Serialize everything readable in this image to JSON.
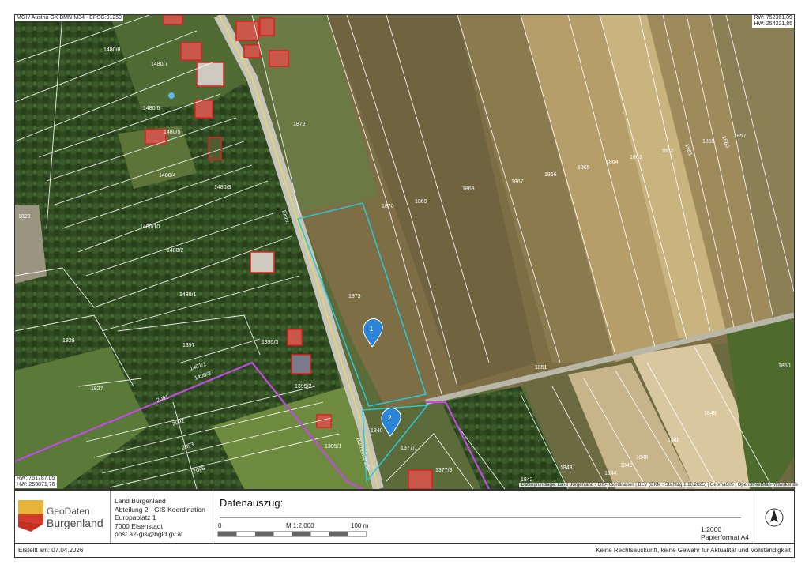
{
  "map": {
    "crs_label": "MGI / Austria GK BMN-M34 - EPSG:31259",
    "coords_top_right": [
      "RW: 752361,09",
      "HW: 254221,85"
    ],
    "coords_bottom_left": [
      "RW: 751787,05",
      "HW: 253871,76"
    ],
    "attribution": "Datengrundlage: Land Burgenland - GIS-Koordination | BEV (DKM - Stichtag 1.10.2025) | GeomaGIS | OpenStreetMap-Mitwirkende",
    "parcels": [
      "1480/8",
      "1480/7",
      "1480/6",
      "1480/5",
      "1480/4",
      "1480/3",
      "1480/10",
      "1480/2",
      "1480/1",
      "1829",
      "1828",
      "1827",
      "1397",
      "1395/3",
      "1395/2",
      "1401/1",
      "1400/3",
      "1872",
      "1873",
      "1870",
      "1869",
      "1868",
      "1867",
      "1866",
      "1865",
      "1864",
      "1863",
      "1862",
      "1861",
      "1860",
      "1859",
      "1857",
      "1851",
      "1850",
      "1849",
      "1848",
      "1846",
      "1845",
      "1844",
      "1843",
      "1842",
      "1840",
      "1377/1",
      "1377/3",
      "1395/1",
      "2091",
      "2092",
      "2093",
      "2095"
    ],
    "street_labels": [
      "Eichr.",
      "Buchenstraße"
    ],
    "markers": [
      {
        "label": "1"
      },
      {
        "label": "2"
      }
    ],
    "colors": {
      "selection": "#29c8d6",
      "boundary": "#c04be0",
      "marker": "#2a85d8",
      "building": "#e02020"
    }
  },
  "legend": {
    "logo_line1": "GeoDaten",
    "logo_line2": "Burgenland",
    "org_lines": [
      "Land Burgenland",
      "Abteilung 2 - GIS Koordination",
      "Europaplatz 1",
      "7000 Eisenstadt",
      "post.a2-gis@bgld.gv.at"
    ],
    "title": "Datenauszug:",
    "scale_start": "0",
    "scale_mid": "M 1:2.000",
    "scale_end": "100 m",
    "scale_text": "1:2000",
    "paper_format": "Papierformat A4"
  },
  "footer": {
    "created": "Erstellt am: 07.04.2026",
    "disclaimer": "Keine Rechtsauskunft, keine Gewähr für Aktualität und Vollständigkeit"
  }
}
